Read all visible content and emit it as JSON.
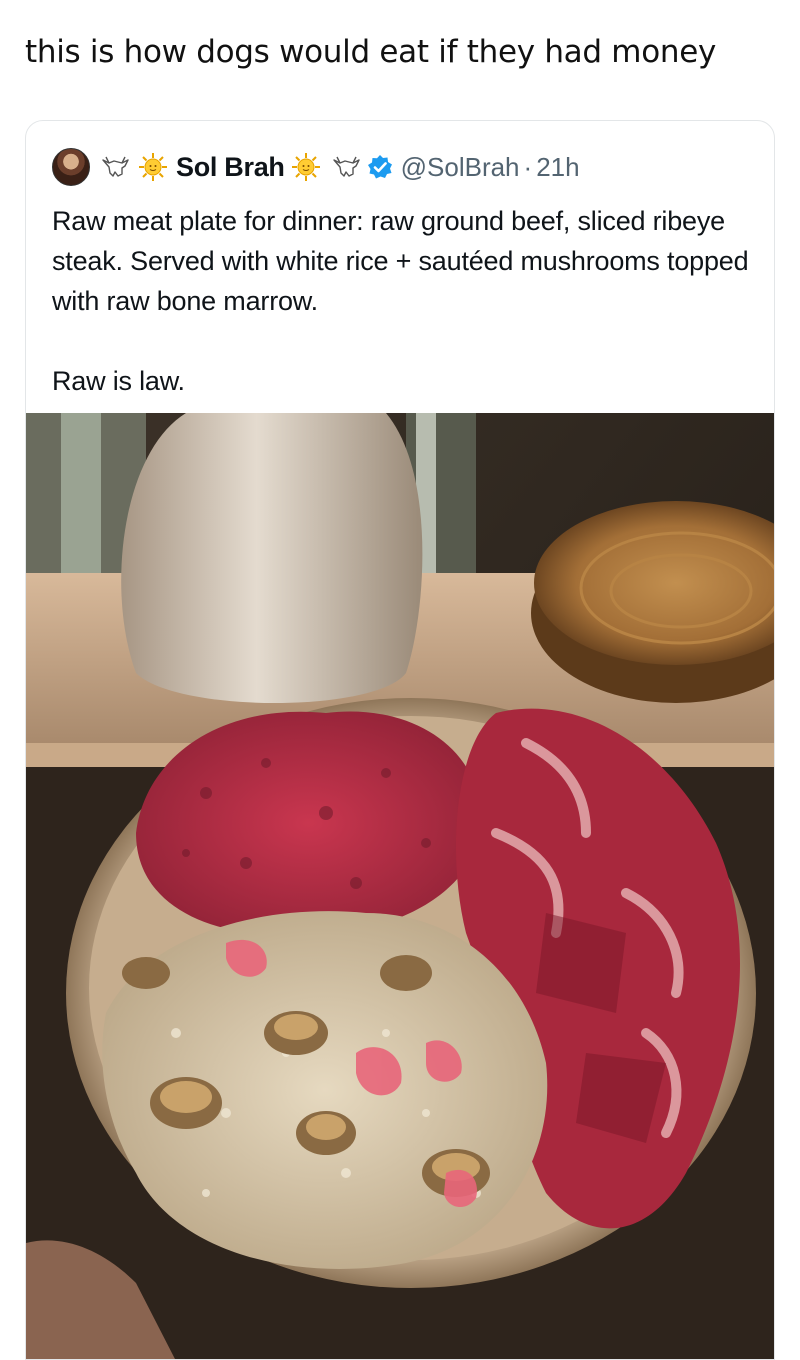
{
  "caption": "this is how dogs would eat if they had money",
  "tweet": {
    "display_name": "Sol Brah",
    "handle": "@SolBrah",
    "separator": "·",
    "time": "21h",
    "text_line_1": "Raw meat plate for dinner: raw ground beef, sliced ribeye steak. Served with white rice + sautéed mushrooms topped with raw bone marrow.",
    "text_line_2": "Raw is law.",
    "icons": [
      "avatar",
      "goat-icon",
      "sun-icon",
      "sun-icon",
      "goat-icon",
      "verified-icon"
    ]
  }
}
